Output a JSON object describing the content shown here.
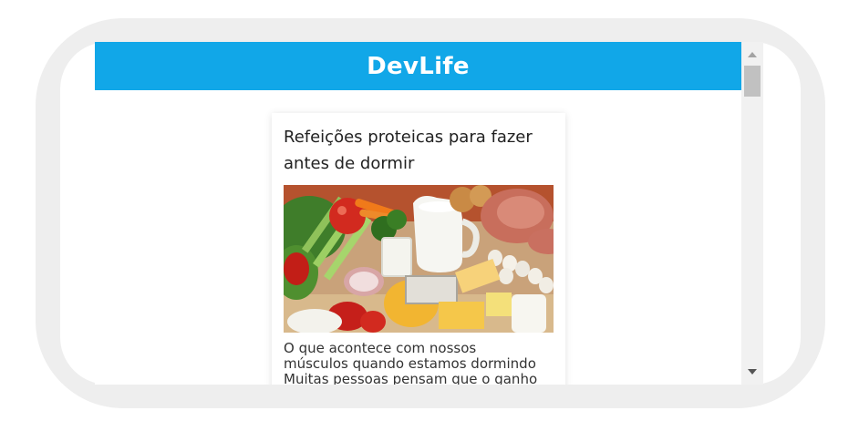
{
  "app": {
    "title": "DevLife"
  },
  "article": {
    "title": "Refeições proteicas para fazer antes de dormir",
    "image_alt": "Refeições proteicas",
    "summary_lines": [
      "O que acontece com nossos",
      "músculos quando estamos dormindo",
      "Muitas pessoas pensam que o ganho"
    ]
  },
  "colors": {
    "header_bg": "#11a7e8",
    "header_text": "#ffffff",
    "frame": "#eeeeee"
  }
}
